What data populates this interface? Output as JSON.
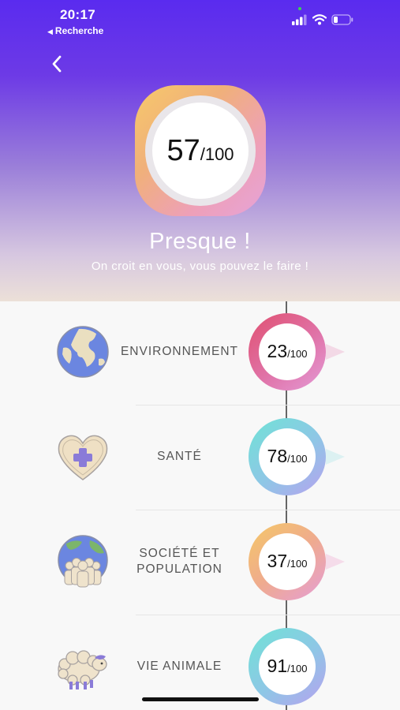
{
  "status_bar": {
    "time": "20:17",
    "back_app_label": "Recherche",
    "icons": [
      "cellular-signal-icon",
      "wifi-icon",
      "battery-icon"
    ]
  },
  "header": {
    "back_icon": "chevron-left-icon",
    "score": "57",
    "score_denominator": "/100",
    "verdict": "Presque !",
    "subtitle": "On croit en vous, vous pouvez le faire !",
    "colors": {
      "gradient_top": "#5a2bef",
      "gradient_bottom": "#ece0d8"
    }
  },
  "categories": [
    {
      "label": "ENVIRONNEMENT",
      "icon": "globe-icon",
      "score": "23",
      "denominator": "/100",
      "ring_colors": [
        "#e05a7a",
        "#e78ac8"
      ]
    },
    {
      "label": "SANTÉ",
      "icon": "heart-medical-cross-icon",
      "score": "78",
      "denominator": "/100",
      "ring_colors": [
        "#6fe0d8",
        "#b4a3ee"
      ]
    },
    {
      "label_line1": "SOCIÉTÉ ET",
      "label_line2": "POPULATION",
      "icon": "people-globe-icon",
      "score": "37",
      "denominator": "/100",
      "ring_colors": [
        "#f6c86a",
        "#e7a0d2"
      ]
    },
    {
      "label": "VIE ANIMALE",
      "icon": "sheep-icon",
      "score": "91",
      "denominator": "/100",
      "ring_colors": [
        "#6fe0d8",
        "#b4a3ee"
      ]
    }
  ]
}
